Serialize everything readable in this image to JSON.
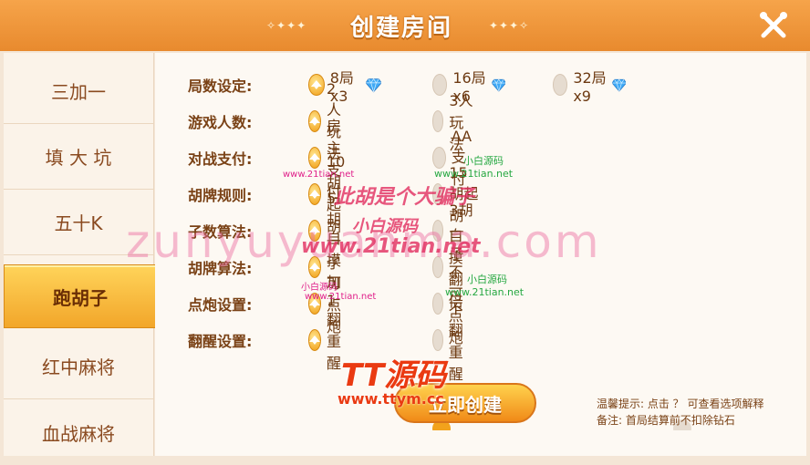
{
  "header": {
    "title": "创建房间",
    "deco_left": "✧✦✦✦",
    "deco_right": "✦✦✦✧",
    "close_icon": "close-x-icon"
  },
  "sidebar": {
    "items": [
      {
        "label": "三加一"
      },
      {
        "label": "填 大 坑"
      },
      {
        "label": "五十K"
      },
      {
        "label": "跑胡子"
      },
      {
        "label": "红中麻将"
      },
      {
        "label": "血战麻将"
      }
    ],
    "active_index": 3
  },
  "settings": {
    "rows": [
      {
        "label": "局数设定:",
        "options": [
          {
            "text": "8局x3",
            "gem": true
          },
          {
            "text": "16局x6",
            "gem": true
          },
          {
            "text": "32局x9",
            "gem": true
          }
        ],
        "selected": 0
      },
      {
        "label": "游戏人数:",
        "options": [
          {
            "text": "2人玩法"
          },
          {
            "text": "3人玩法"
          }
        ],
        "selected": 0
      },
      {
        "label": "对战支付:",
        "options": [
          {
            "text": "房主支付"
          },
          {
            "text": "AA支付"
          }
        ],
        "selected": 0
      },
      {
        "label": "胡牌规则:",
        "options": [
          {
            "text": "10胡起胡"
          },
          {
            "text": "15胡起胡"
          }
        ],
        "selected": 0
      },
      {
        "label": "子数算法:",
        "options": [
          {
            "text": "5胡一子"
          },
          {
            "text": "3胡一子"
          }
        ],
        "selected": 0
      },
      {
        "label": "胡牌算法:",
        "options": [
          {
            "text": "自摸加1"
          },
          {
            "text": "自摸翻倍"
          }
        ],
        "selected": 0
      },
      {
        "label": "点炮设置:",
        "options": [
          {
            "text": "可点炮"
          },
          {
            "text": "不可点炮"
          }
        ],
        "selected": 0
      },
      {
        "label": "翻醒设置:",
        "options": [
          {
            "text": "翻重醒"
          },
          {
            "text": "不翻重醒"
          }
        ],
        "selected": 0
      }
    ]
  },
  "footer": {
    "create_label": "立即创建",
    "tip_line1": "温馨提示: 点击 ？ 可查看选项解释",
    "tip_line2": "备注: 首局结算前不扣除钻石"
  },
  "watermarks": {
    "big": "zunyuyuanma.com",
    "red1": "此胡是个大骗子",
    "red2": "小白源码",
    "red3": "www.21tian.net",
    "small1": "www.21tian.net",
    "small2": "小白源码",
    "small3": "www.21tian.net",
    "green1": "小白源码",
    "green2": "www.21tian.net",
    "green3": "小白源码",
    "green4": "www.21tian.net",
    "tt": "TT源码",
    "tt_url": "www.ttym.cc"
  },
  "colors": {
    "accent": "#f2a21c",
    "header": "#e88a2e",
    "text": "#7a4216"
  }
}
